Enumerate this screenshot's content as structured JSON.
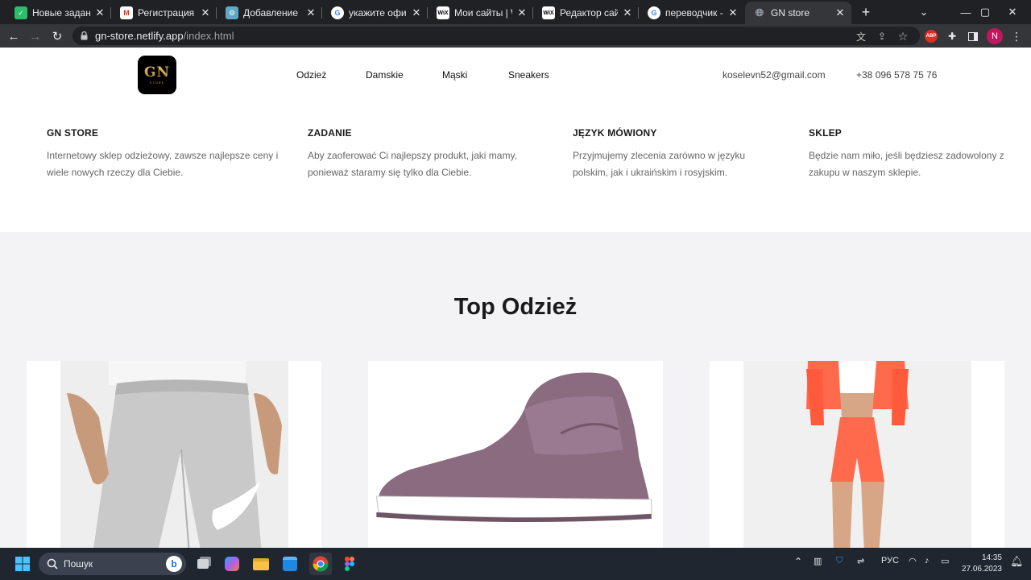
{
  "browser": {
    "tabs": [
      {
        "title": "Новые задания",
        "icon": "checkmark-icon"
      },
      {
        "title": "Регистрация на f",
        "icon": "gmail-icon"
      },
      {
        "title": "Добавление раб",
        "icon": "app-icon"
      },
      {
        "title": "укажите официа",
        "icon": "google-icon"
      },
      {
        "title": "Мои сайты | Wix",
        "icon": "wix-icon"
      },
      {
        "title": "Редактор сайтов",
        "icon": "wix-icon"
      },
      {
        "title": "переводчик - По",
        "icon": "google-icon"
      },
      {
        "title": "GN store",
        "icon": "globe-icon"
      }
    ],
    "url_host": "gn-store.netlify.app",
    "url_path": "/index.html",
    "abp_label": "ABP",
    "profile_initial": "N"
  },
  "site": {
    "logo_text": "GN",
    "logo_sub": "STORE",
    "nav": [
      "Odzież",
      "Damskie",
      "Mąski",
      "Sneakers"
    ],
    "email": "koselevn52@gmail.com",
    "phone": "+38 096 578 75 76",
    "info": [
      {
        "title": "GN STORE",
        "lines": [
          "Internetowy sklep odzieżowy, zawsze najlepsze ceny i",
          "wiele nowych rzeczy dla Ciebie."
        ]
      },
      {
        "title": "ZADANIE",
        "lines": [
          "Aby zaoferować Ci najlepszy produkt, jaki mamy,",
          "ponieważ staramy się tylko dla Ciebie."
        ]
      },
      {
        "title": "JĘZYK MÓWIONY",
        "lines": [
          "Przyjmujemy zlecenia zarówno w języku",
          "polskim, jak i ukraińskim i rosyjskim."
        ]
      },
      {
        "title": "SKLEP",
        "lines": [
          "Będzie nam miło, jeśli będziesz zadowolony z",
          "zakupu w naszym sklepie."
        ]
      }
    ],
    "section_title": "Top Odzież",
    "products": [
      {
        "image": "gray-sweatpants-photo"
      },
      {
        "image": "purple-sneaker-photo"
      },
      {
        "image": "orange-sportswear-photo"
      }
    ]
  },
  "taskbar": {
    "search_placeholder": "Пошук",
    "language": "РУС",
    "time": "14:35",
    "date": "27.06.2023"
  },
  "colors": {
    "chrome_dark": "#202124",
    "chrome_toolbar": "#35363a",
    "page_gray": "#f3f3f6",
    "taskbar": "#1f2630",
    "profile": "#c2185b"
  }
}
